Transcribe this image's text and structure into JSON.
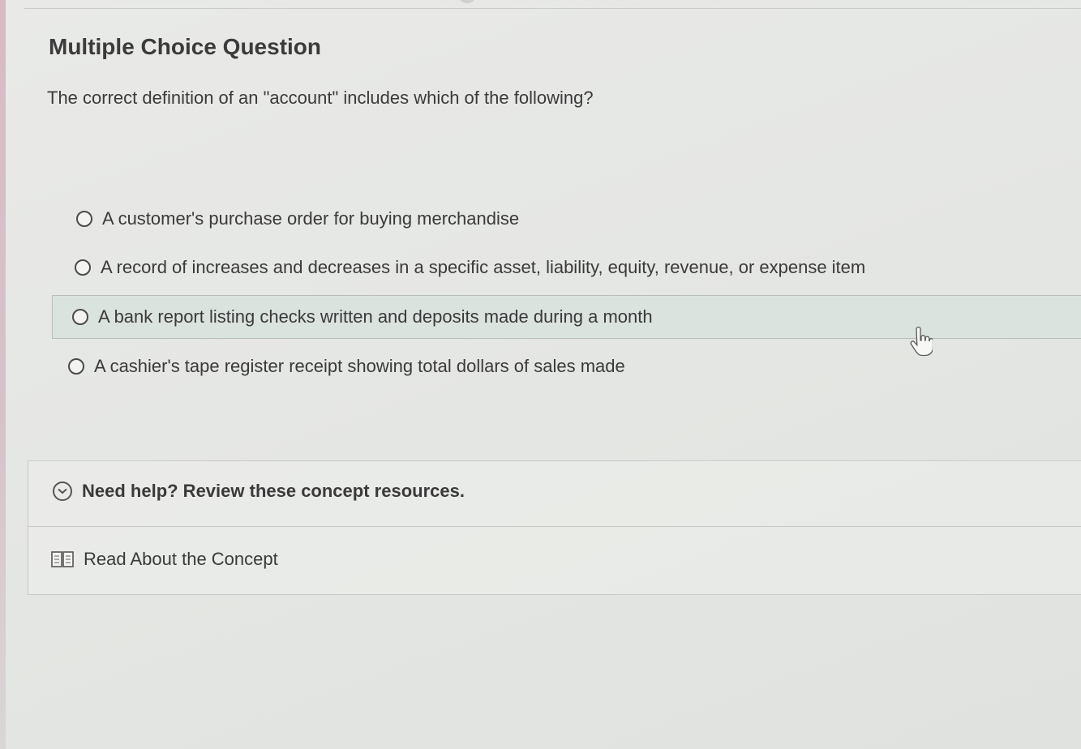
{
  "question": {
    "type_label": "Multiple Choice Question",
    "prompt": "The correct definition of an \"account\" includes which of the following?"
  },
  "options": [
    {
      "label": "A customer's purchase order for buying merchandise",
      "selected": false
    },
    {
      "label": "A record of increases and decreases in a specific asset, liability, equity, revenue, or expense item",
      "selected": false
    },
    {
      "label": "A bank report listing checks written and deposits made during a month",
      "selected": false
    },
    {
      "label": "A cashier's tape register receipt showing total dollars of sales made",
      "selected": false
    }
  ],
  "help": {
    "toggle_label": "Need help? Review these concept resources.",
    "resource_label": "Read About the Concept"
  },
  "icons": {
    "toggle": "chevron-down-circle-icon",
    "resource": "book-icon",
    "cursor": "hand-pointer-icon"
  },
  "colors": {
    "hover_row": "#dbe3df",
    "text": "#3a3a3a"
  }
}
